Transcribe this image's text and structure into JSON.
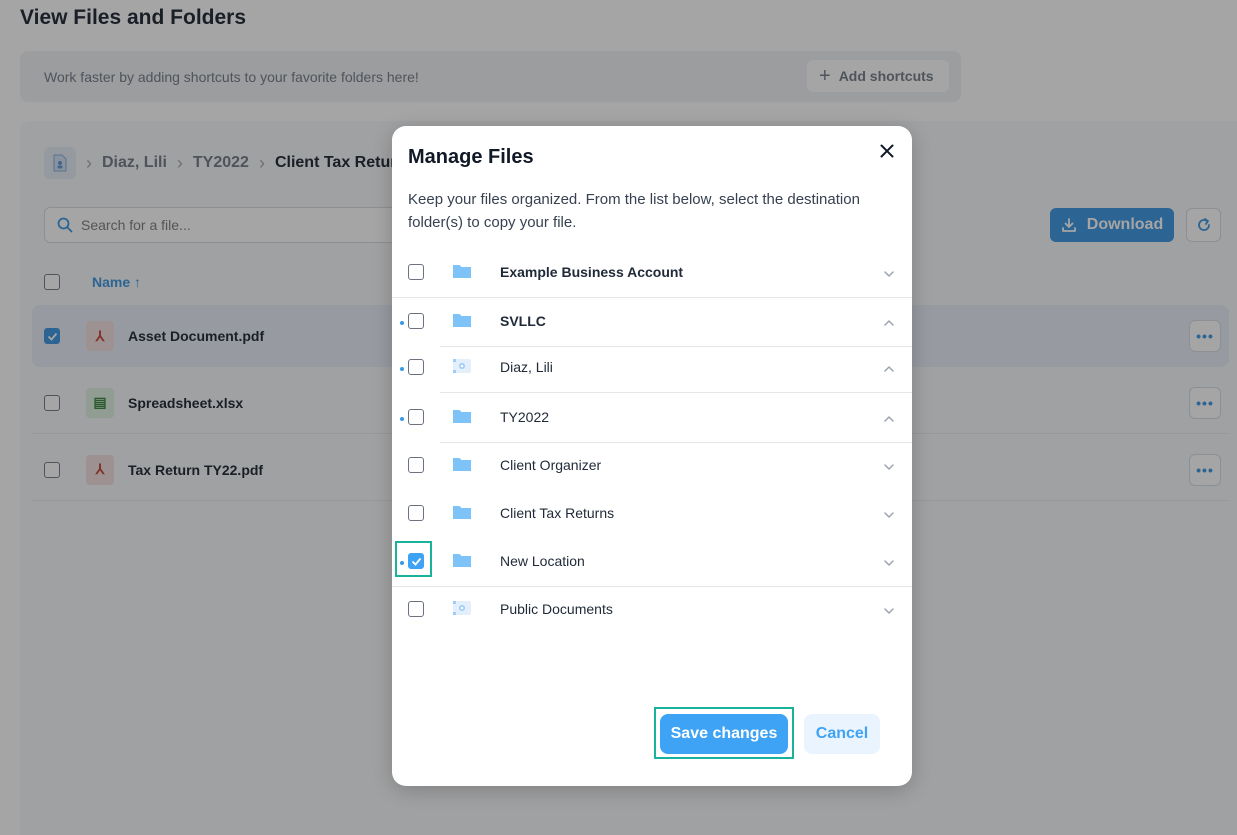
{
  "page": {
    "title": "View Files and Folders",
    "shortcut_hint": "Work faster by adding shortcuts to your favorite folders here!",
    "add_shortcuts_label": "Add shortcuts",
    "breadcrumb": [
      "Diaz, Lili",
      "TY2022",
      "Client Tax Returns"
    ],
    "search_placeholder": "Search for a file...",
    "download_label": "Download",
    "name_column": "Name",
    "files": [
      {
        "name": "Asset Document.pdf",
        "type": "pdf",
        "selected": true
      },
      {
        "name": "Spreadsheet.xlsx",
        "type": "xlsx",
        "selected": false
      },
      {
        "name": "Tax Return TY22.pdf",
        "type": "pdf",
        "selected": false
      }
    ],
    "accent_color": "#2f8fe0"
  },
  "modal": {
    "title": "Manage Files",
    "description": "Keep your files organized. From the list below, select the destination folder(s) to copy your file.",
    "folders": [
      {
        "name": "Example Business Account",
        "icon": "folder-icon",
        "checked": false,
        "bold": true,
        "dot": false,
        "expanded": false
      },
      {
        "name": "SVLLC",
        "icon": "folder-icon",
        "checked": false,
        "bold": true,
        "dot": true,
        "expanded": true
      },
      {
        "name": "Diaz, Lili",
        "icon": "client-folder-icon",
        "checked": false,
        "bold": false,
        "dot": true,
        "expanded": true
      },
      {
        "name": "TY2022",
        "icon": "folder-icon",
        "checked": false,
        "bold": false,
        "dot": true,
        "expanded": true
      },
      {
        "name": "Client Organizer",
        "icon": "folder-icon",
        "checked": false,
        "bold": false,
        "dot": false,
        "expanded": false
      },
      {
        "name": "Client Tax Returns",
        "icon": "folder-icon",
        "checked": false,
        "bold": false,
        "dot": false,
        "expanded": false
      },
      {
        "name": "New Location",
        "icon": "folder-icon",
        "checked": true,
        "bold": false,
        "dot": true,
        "expanded": false
      },
      {
        "name": "Public Documents",
        "icon": "shared-folder-icon",
        "checked": false,
        "bold": false,
        "dot": false,
        "expanded": false
      }
    ],
    "save_label": "Save changes",
    "cancel_label": "Cancel",
    "highlight_color": "#19b39c",
    "primary_color": "#3ea3f4"
  }
}
